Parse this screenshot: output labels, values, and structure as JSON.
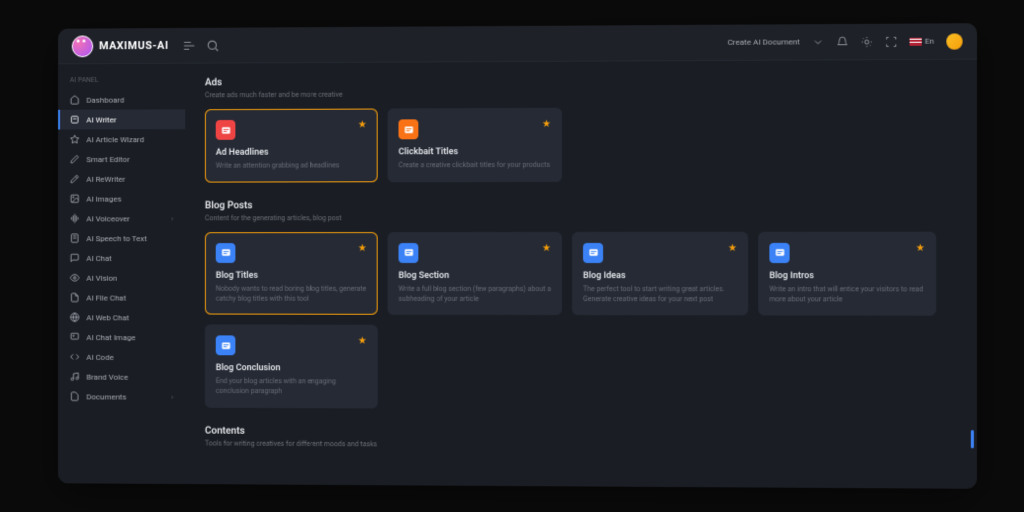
{
  "brand": "MAXIMUS-AI",
  "header": {
    "create_label": "Create AI Document",
    "lang": "En"
  },
  "sidebar": {
    "section": "AI PANEL",
    "items": [
      {
        "label": "Dashboard",
        "icon": "home"
      },
      {
        "label": "AI Writer",
        "icon": "writer",
        "active": true
      },
      {
        "label": "AI Article Wizard",
        "icon": "wizard"
      },
      {
        "label": "Smart Editor",
        "icon": "edit"
      },
      {
        "label": "AI ReWriter",
        "icon": "rewrite"
      },
      {
        "label": "AI Images",
        "icon": "image"
      },
      {
        "label": "AI Voiceover",
        "icon": "voice",
        "chevron": true
      },
      {
        "label": "AI Speech to Text",
        "icon": "speech"
      },
      {
        "label": "AI Chat",
        "icon": "chat"
      },
      {
        "label": "AI Vision",
        "icon": "vision"
      },
      {
        "label": "AI File Chat",
        "icon": "file"
      },
      {
        "label": "AI Web Chat",
        "icon": "web"
      },
      {
        "label": "AI Chat Image",
        "icon": "chatimg"
      },
      {
        "label": "AI Code",
        "icon": "code"
      },
      {
        "label": "Brand Voice",
        "icon": "brand"
      },
      {
        "label": "Documents",
        "icon": "doc",
        "chevron": true
      }
    ]
  },
  "sections": [
    {
      "title": "Ads",
      "desc": "Create ads much faster and be more creative",
      "cards": [
        {
          "title": "Ad Headlines",
          "desc": "Write an attention grabbing ad headlines",
          "color": "red",
          "selected": true
        },
        {
          "title": "Clickbait Titles",
          "desc": "Create a creative clickbait titles for your products",
          "color": "orange"
        }
      ]
    },
    {
      "title": "Blog Posts",
      "desc": "Content for the generating articles, blog post",
      "cards": [
        {
          "title": "Blog Titles",
          "desc": "Nobody wants to read boring blog titles, generate catchy blog titles with this tool",
          "color": "blue",
          "selected": true
        },
        {
          "title": "Blog Section",
          "desc": "Write a full blog section (few paragraphs) about a subheading of your article",
          "color": "blue"
        },
        {
          "title": "Blog Ideas",
          "desc": "The perfect tool to start writing great articles. Generate creative ideas for your next post",
          "color": "blue"
        },
        {
          "title": "Blog Intros",
          "desc": "Write an intro that will entice your visitors to read more about your article",
          "color": "blue"
        },
        {
          "title": "Blog Conclusion",
          "desc": "End your blog articles with an engaging conclusion paragraph",
          "color": "blue"
        }
      ]
    },
    {
      "title": "Contents",
      "desc": "Tools for writing creatives for different moods and tasks",
      "cards": []
    }
  ]
}
